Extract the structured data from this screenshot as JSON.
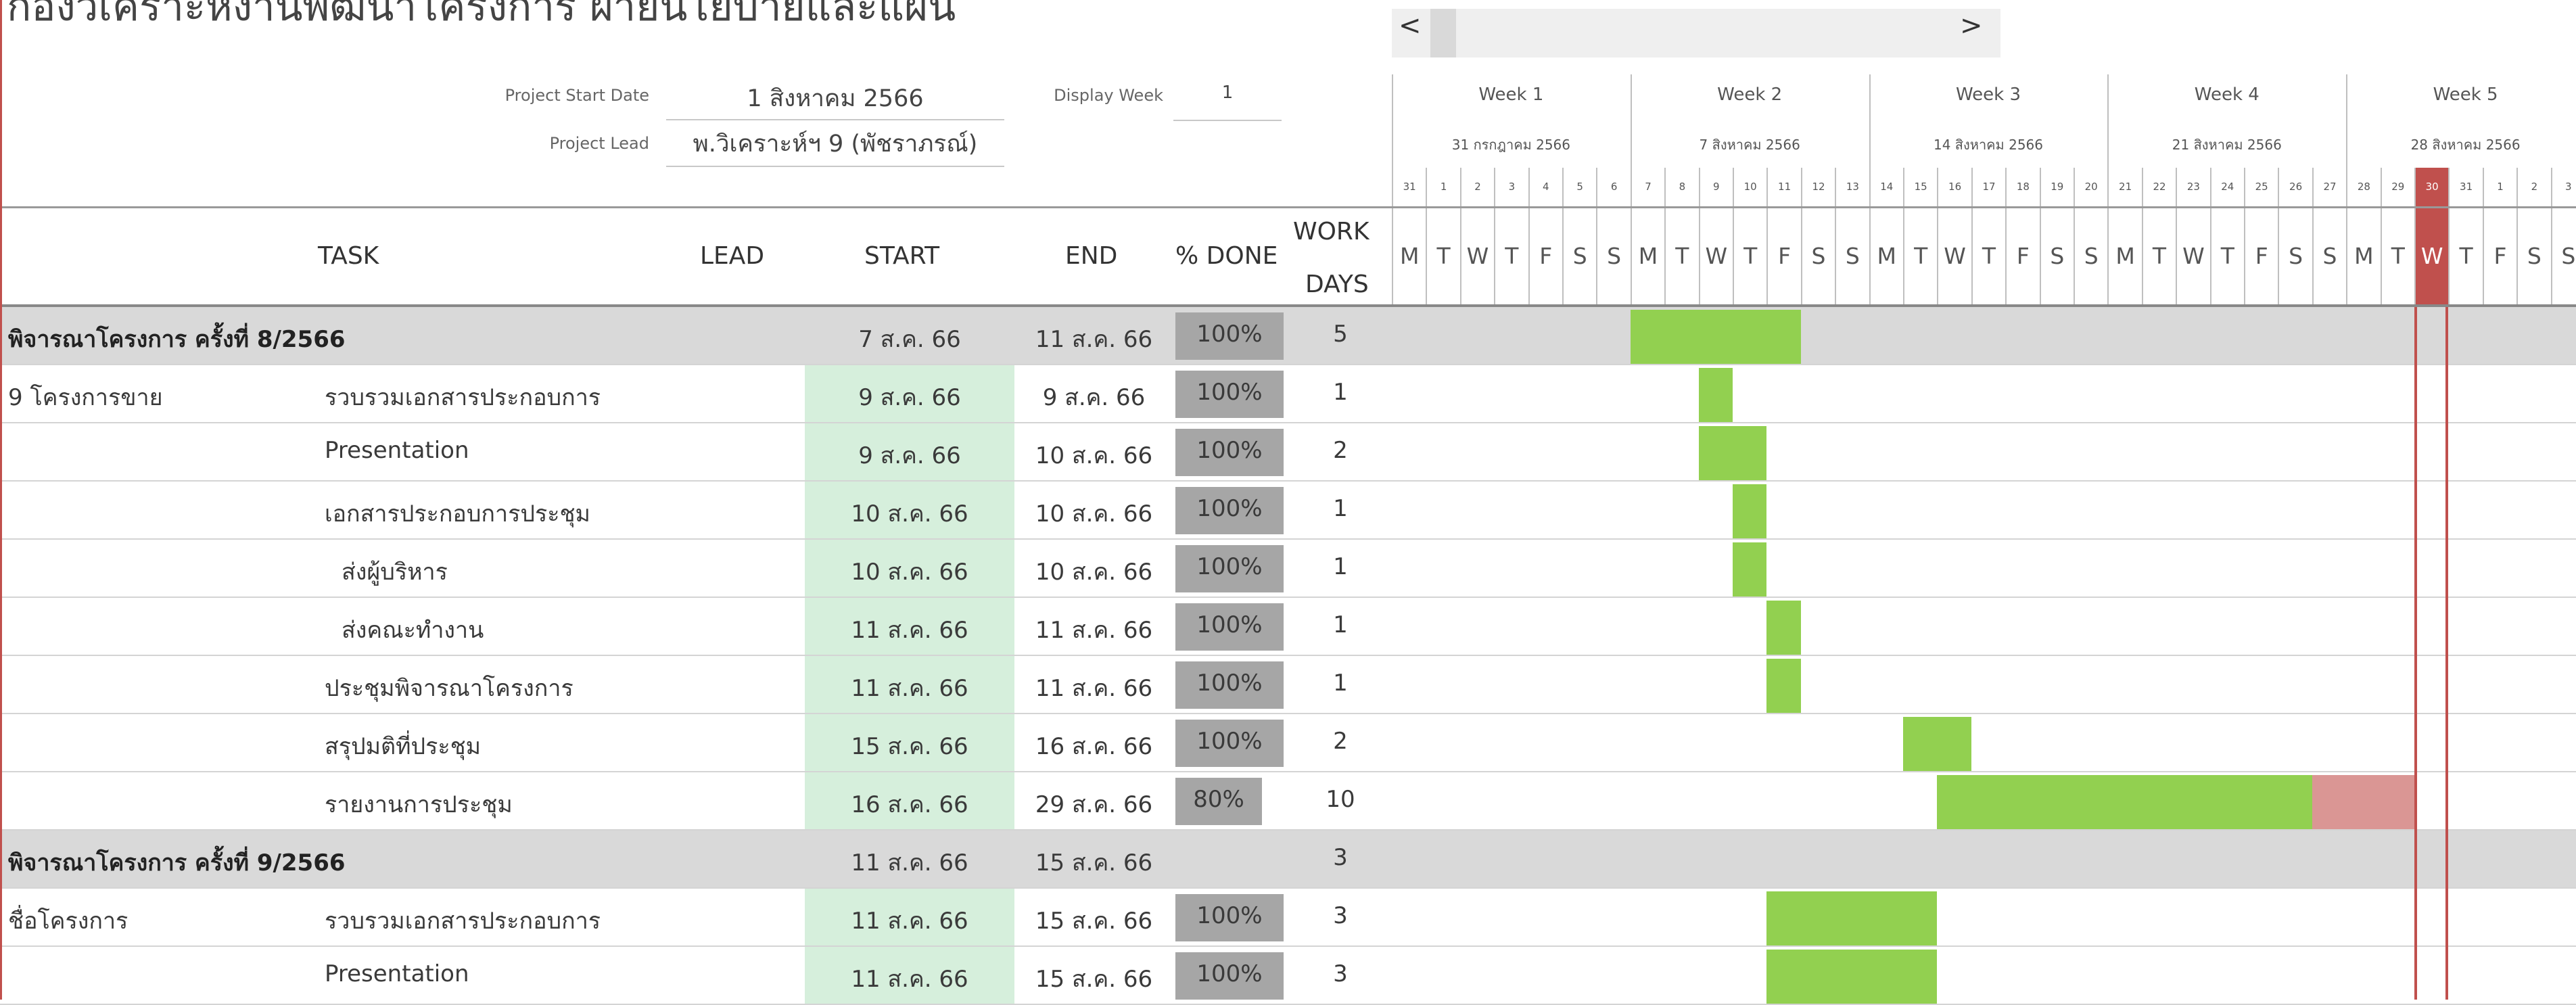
{
  "sheet": {
    "title": "กองวิเคราะห์งานพัฒนาโครงการ ฝ่ายนโยบายและแผน",
    "project_start_label": "Project Start Date",
    "project_start_value": "1 สิงหาคม 2566",
    "project_lead_label": "Project Lead",
    "project_lead_value": "พ.วิเคราะห์ฯ 9 (พัชราภรณ์)",
    "display_week_label": "Display Week",
    "display_week_value": "1"
  },
  "scroll": {
    "left": "<",
    "right": ">"
  },
  "weeks": [
    {
      "label": "Week 1",
      "date": "31 กรกฎาคม 2566"
    },
    {
      "label": "Week 2",
      "date": "7 สิงหาคม 2566"
    },
    {
      "label": "Week 3",
      "date": "14 สิงหาคม 2566"
    },
    {
      "label": "Week 4",
      "date": "21 สิงหาคม 2566"
    },
    {
      "label": "Week 5",
      "date": "28 สิงหาคม 2566"
    }
  ],
  "day_numbers": [
    "31",
    "1",
    "2",
    "3",
    "4",
    "5",
    "6",
    "7",
    "8",
    "9",
    "10",
    "11",
    "12",
    "13",
    "14",
    "15",
    "16",
    "17",
    "18",
    "19",
    "20",
    "21",
    "22",
    "23",
    "24",
    "25",
    "26",
    "27",
    "28",
    "29",
    "30",
    "31",
    "1",
    "2",
    "3"
  ],
  "day_letters": [
    "M",
    "T",
    "W",
    "T",
    "F",
    "S",
    "S",
    "M",
    "T",
    "W",
    "T",
    "F",
    "S",
    "S",
    "M",
    "T",
    "W",
    "T",
    "F",
    "S",
    "S",
    "M",
    "T",
    "W",
    "T",
    "F",
    "S",
    "S",
    "M",
    "T",
    "W",
    "T",
    "F",
    "S",
    "S"
  ],
  "today_index": 30,
  "columns": {
    "task": "TASK",
    "lead": "LEAD",
    "start": "START",
    "end": "END",
    "pct": "% DONE",
    "work1": "WORK",
    "work2": "DAYS"
  },
  "rows": [
    {
      "group": true,
      "col1": "พิจารณาโครงการ ครั้งที่ 8/2566",
      "task": "",
      "start": "7 ส.ค. 66",
      "end": "11 ส.ค. 66",
      "pct": "100%",
      "pct_value": 100,
      "days": "5",
      "bar_start": 7,
      "bar_len": 5,
      "bar_done": 5
    },
    {
      "group": false,
      "col1": "9 โครงการขาย",
      "task": "รวบรวมเอกสารประกอบการ",
      "start": "9 ส.ค. 66",
      "end": "9 ส.ค. 66",
      "pct": "100%",
      "pct_value": 100,
      "days": "1",
      "bar_start": 9,
      "bar_len": 1,
      "bar_done": 1
    },
    {
      "group": false,
      "col1": "",
      "task": "Presentation",
      "start": "9 ส.ค. 66",
      "end": "10 ส.ค. 66",
      "pct": "100%",
      "pct_value": 100,
      "days": "2",
      "bar_start": 9,
      "bar_len": 2,
      "bar_done": 2
    },
    {
      "group": false,
      "col1": "",
      "task": "เอกสารประกอบการประชุม",
      "start": "10 ส.ค. 66",
      "end": "10 ส.ค. 66",
      "pct": "100%",
      "pct_value": 100,
      "days": "1",
      "bar_start": 10,
      "bar_len": 1,
      "bar_done": 1
    },
    {
      "group": false,
      "col1": "",
      "task": "  ส่งผู้บริหาร",
      "start": "10 ส.ค. 66",
      "end": "10 ส.ค. 66",
      "pct": "100%",
      "pct_value": 100,
      "days": "1",
      "bar_start": 10,
      "bar_len": 1,
      "bar_done": 1
    },
    {
      "group": false,
      "col1": "",
      "task": "  ส่งคณะทำงาน",
      "start": "11 ส.ค. 66",
      "end": "11 ส.ค. 66",
      "pct": "100%",
      "pct_value": 100,
      "days": "1",
      "bar_start": 11,
      "bar_len": 1,
      "bar_done": 1
    },
    {
      "group": false,
      "col1": "",
      "task": "ประชุมพิจารณาโครงการ",
      "start": "11 ส.ค. 66",
      "end": "11 ส.ค. 66",
      "pct": "100%",
      "pct_value": 100,
      "days": "1",
      "bar_start": 11,
      "bar_len": 1,
      "bar_done": 1
    },
    {
      "group": false,
      "col1": "",
      "task": "สรุปมติที่ประชุม",
      "start": "15 ส.ค. 66",
      "end": "16 ส.ค. 66",
      "pct": "100%",
      "pct_value": 100,
      "days": "2",
      "bar_start": 15,
      "bar_len": 2,
      "bar_done": 2
    },
    {
      "group": false,
      "col1": "",
      "task": "รายงานการประชุม",
      "start": "16 ส.ค. 66",
      "end": "29 ส.ค. 66",
      "pct": "80%",
      "pct_value": 80,
      "days": "10",
      "bar_start": 16,
      "bar_len": 14,
      "bar_done": 11
    },
    {
      "group": true,
      "col1": "พิจารณาโครงการ ครั้งที่ 9/2566",
      "task": "",
      "start": "11 ส.ค. 66",
      "end": "15 ส.ค. 66",
      "pct": "",
      "pct_value": 0,
      "days": "3",
      "bar_start": 0,
      "bar_len": 0,
      "bar_done": 0
    },
    {
      "group": false,
      "col1": "ชื่อโครงการ",
      "task": "รวบรวมเอกสารประกอบการ",
      "start": "11 ส.ค. 66",
      "end": "15 ส.ค. 66",
      "pct": "100%",
      "pct_value": 100,
      "days": "3",
      "bar_start": 11,
      "bar_len": 5,
      "bar_done": 5
    },
    {
      "group": false,
      "col1": "",
      "task": "Presentation",
      "start": "11 ส.ค. 66",
      "end": "15 ส.ค. 66",
      "pct": "100%",
      "pct_value": 100,
      "days": "3",
      "bar_start": 11,
      "bar_len": 5,
      "bar_done": 5
    }
  ],
  "colors": {
    "bar_done": "#92d050",
    "bar_remaining": "#da9694",
    "today": "#c0504d",
    "group_row": "#d9d9d9",
    "start_cell": "#d6efdc",
    "pct_box": "#a6a6a6"
  }
}
